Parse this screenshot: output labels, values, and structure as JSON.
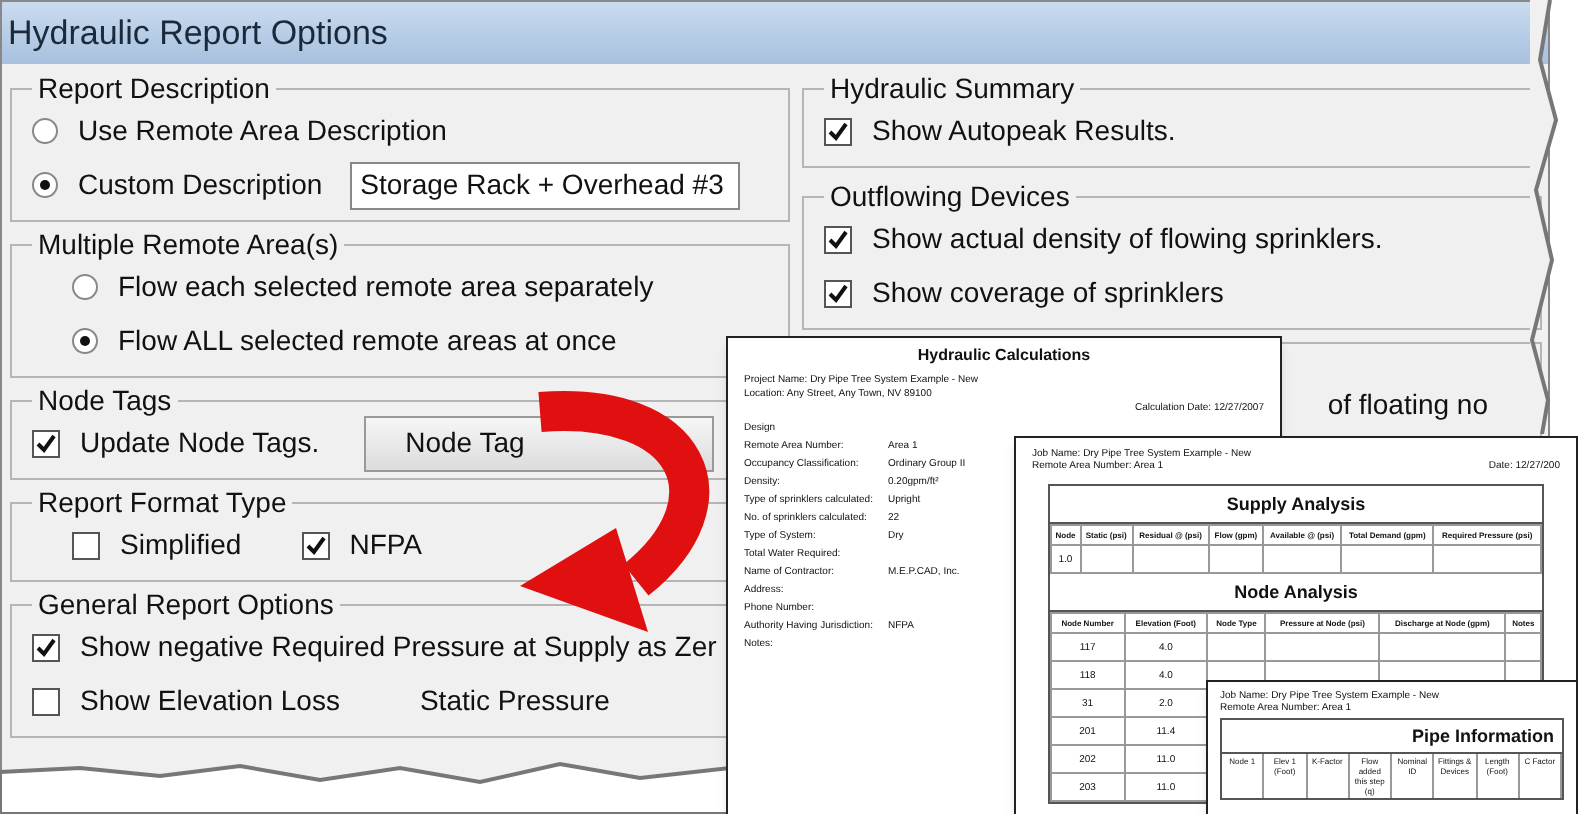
{
  "window": {
    "title": "Hydraulic Report Options"
  },
  "left_groups": [
    {
      "title": "Report Description",
      "kind": "column",
      "items": [
        {
          "kind": "radio",
          "label": "Use Remote Area Description",
          "selected": false
        },
        {
          "kind": "radio",
          "label": "Custom Description",
          "selected": true,
          "value": "Storage Rack + Overhead #3"
        }
      ]
    },
    {
      "title": "Multiple Remote Area(s)",
      "kind": "indented_column",
      "items": [
        {
          "kind": "radio",
          "label": "Flow each selected remote area separately",
          "selected": false
        },
        {
          "kind": "radio",
          "label": "Flow ALL selected remote areas at once",
          "selected": true
        }
      ]
    },
    {
      "title": "Node Tags",
      "kind": "column",
      "items": [
        {
          "kind": "checkbox",
          "label": "Update Node Tags.",
          "checked": true,
          "button": "Node Tag"
        }
      ]
    },
    {
      "title": "Report Format Type",
      "kind": "indented_row",
      "items": [
        {
          "kind": "checkbox",
          "label": "Simplified",
          "checked": false
        },
        {
          "kind": "checkbox",
          "label": "NFPA",
          "checked": true
        }
      ]
    },
    {
      "title": "General Report Options",
      "kind": "column",
      "items": [
        {
          "kind": "checkbox",
          "label": "Show negative Required Pressure at Supply as Zer",
          "checked": true
        },
        {
          "kind": "checkbox",
          "label": "Show Elevation Loss",
          "checked": false,
          "trailing": "Static Pressure"
        }
      ]
    }
  ],
  "right_groups": [
    {
      "title": "Hydraulic Summary",
      "items": [
        {
          "kind": "checkbox",
          "label": "Show Autopeak Results.",
          "checked": true
        }
      ]
    },
    {
      "title": "Outflowing Devices",
      "items": [
        {
          "kind": "checkbox",
          "label": "Show actual density of flowing sprinklers.",
          "checked": true
        },
        {
          "kind": "checkbox",
          "label": "Show coverage of sprinklers",
          "checked": true
        }
      ]
    },
    {
      "items": [
        {
          "kind": "text",
          "label": "of floating no"
        }
      ]
    }
  ],
  "report_pages": [
    {
      "kind": "calculations",
      "title": "Hydraulic Calculations",
      "header_lines": [
        "Project Name: Dry Pipe Tree System Example - New",
        "Location: Any Street, Any Town, NV 89100"
      ],
      "date": "Calculation Date: 12/27/2007",
      "fields": [
        {
          "label": "Design"
        },
        {
          "label": "Remote Area Number:",
          "value": "Area 1"
        },
        {
          "label": "Occupancy Classification:",
          "value": "Ordinary Group II"
        },
        {
          "label": "Density:",
          "value": "0.20gpm/ft²"
        },
        {
          "label": "Type of sprinklers calculated:",
          "value": "Upright"
        },
        {
          "label": "No. of sprinklers calculated:",
          "value": "22"
        },
        {
          "label": "Type of System:",
          "value": "Dry"
        },
        {
          "label": "Total Water Required:"
        },
        {
          "label": "Name of Contractor:",
          "value": "M.E.P.CAD, Inc."
        },
        {
          "label": "Address:"
        },
        {
          "label": "Phone Number:"
        },
        {
          "label": "Authority Having Jurisdiction:",
          "value": "NFPA"
        },
        {
          "label": "Notes:"
        }
      ]
    },
    {
      "kind": "analysis",
      "header_lines": [
        "Job Name: Dry Pipe Tree System Example - New",
        "Remote Area Number: Area 1"
      ],
      "date": "Date: 12/27/200",
      "sections": [
        {
          "title": "Supply Analysis",
          "columns": [
            "Node",
            "Static (psi)",
            "Residual @ (psi)",
            "Flow (gpm)",
            "Available @ (psi)",
            "Total Demand (gpm)",
            "Required Pressure (psi)"
          ],
          "rows": [
            [
              "1.0",
              "",
              "",
              "",
              "",
              "",
              ""
            ]
          ]
        },
        {
          "title": "Node Analysis",
          "columns": [
            "Node Number",
            "Elevation (Foot)",
            "Node Type",
            "Pressure at Node (psi)",
            "Discharge at Node (gpm)",
            "Notes"
          ],
          "rows": [
            [
              "117",
              "4.0",
              "",
              "",
              "",
              ""
            ],
            [
              "118",
              "4.0",
              "",
              "",
              "",
              ""
            ],
            [
              "31",
              "2.0",
              "",
              "",
              "",
              ""
            ],
            [
              "201",
              "11.4",
              "",
              "",
              "",
              ""
            ],
            [
              "202",
              "11.0",
              "",
              "",
              "",
              ""
            ],
            [
              "203",
              "11.0",
              "",
              "",
              "",
              ""
            ]
          ]
        }
      ]
    },
    {
      "kind": "pipes",
      "header_lines": [
        "Job Name: Dry Pipe Tree System Example - New",
        "Remote Area Number: Area 1"
      ],
      "title": "Pipe Information",
      "columns": [
        "Node 1",
        "Elev 1 (Foot)",
        "K-Factor",
        "Flow added this step (q)",
        "Nominal ID",
        "Fittings & Devices",
        "Length (Foot)",
        "C Factor"
      ]
    }
  ]
}
